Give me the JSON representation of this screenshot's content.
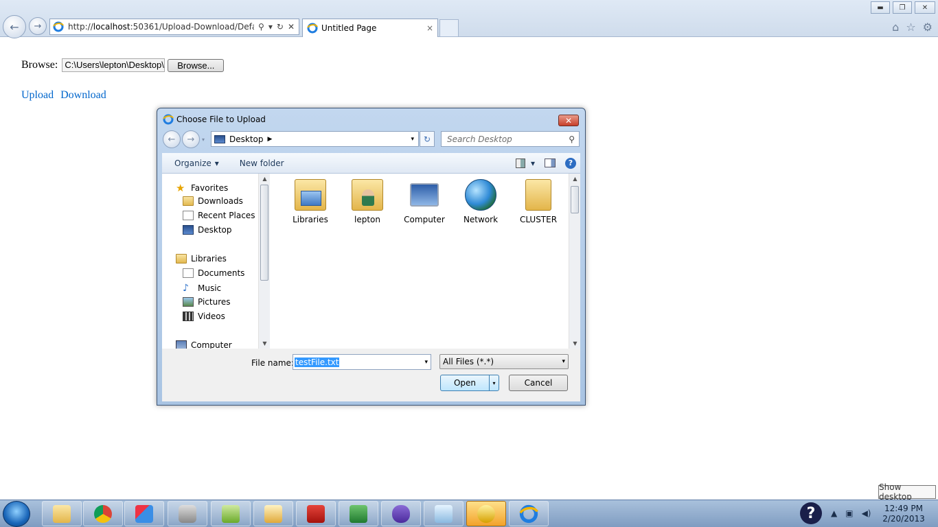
{
  "browser": {
    "url_prefix": "http://",
    "url_host": "localhost",
    "url_rest": ":50361/Upload-Download/Defau",
    "tab_title": "Untitled Page",
    "tab_close": "×",
    "search_glyph": "⚲",
    "dropdown_glyph": "▾",
    "refresh_glyph": "↻",
    "stop_glyph": "✕",
    "back_glyph": "←",
    "forward_glyph": "→",
    "home_glyph": "⌂",
    "favorites_glyph": "☆",
    "tools_glyph": "⚙",
    "minimize_glyph": "▬",
    "restore_glyph": "❐",
    "close_glyph": "✕"
  },
  "page": {
    "browse_label": "Browse:",
    "file_path": "C:\\Users\\lepton\\Desktop\\",
    "browse_button": "Browse...",
    "upload_link": "Upload",
    "download_link": "Download"
  },
  "dialog": {
    "title": "Choose File to Upload",
    "close_glyph": "✕",
    "location": "Desktop",
    "search_placeholder": "Search Desktop",
    "organize": "Organize",
    "new_folder": "New folder",
    "help_glyph": "?",
    "nav_items": [
      {
        "label": "Favorites",
        "icon": "star-icon"
      },
      {
        "label": "Downloads",
        "icon": "downloads-folder-icon"
      },
      {
        "label": "Recent Places",
        "icon": "recent-places-icon"
      },
      {
        "label": "Desktop",
        "icon": "desktop-icon"
      },
      {
        "label": "Libraries",
        "icon": "libraries-icon"
      },
      {
        "label": "Documents",
        "icon": "documents-icon"
      },
      {
        "label": "Music",
        "icon": "music-icon"
      },
      {
        "label": "Pictures",
        "icon": "pictures-icon"
      },
      {
        "label": "Videos",
        "icon": "videos-icon"
      },
      {
        "label": "Computer",
        "icon": "computer-icon"
      }
    ],
    "files": [
      {
        "label": "Libraries",
        "icon": "libraries-icon"
      },
      {
        "label": "lepton",
        "icon": "user-folder-icon"
      },
      {
        "label": "Computer",
        "icon": "computer-icon"
      },
      {
        "label": "Network",
        "icon": "network-icon"
      },
      {
        "label": "CLUSTER",
        "icon": "folder-icon"
      }
    ],
    "file_name_label": "File name:",
    "file_name_value": "testFile.txt",
    "filter_value": "All Files (*.*)",
    "open_button": "Open",
    "cancel_button": "Cancel"
  },
  "taskbar": {
    "time": "12:49 PM",
    "date": "2/20/2013",
    "show_desktop_tip": "Show desktop",
    "tray_up_glyph": "▲",
    "help_glyph": "?"
  }
}
